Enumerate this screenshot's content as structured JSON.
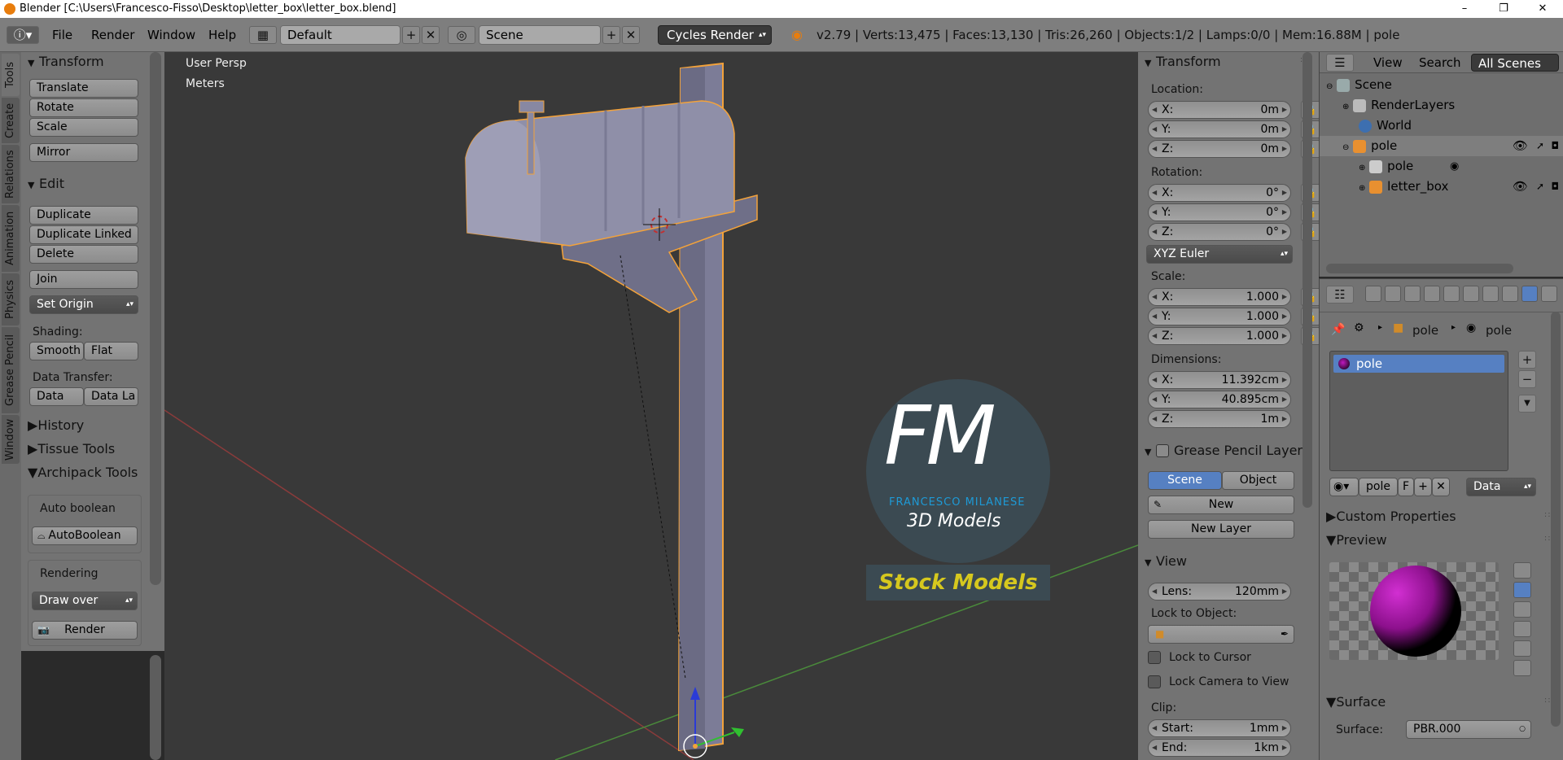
{
  "window": {
    "title": "Blender [C:\\Users\\Francesco-Fisso\\Desktop\\letter_box\\letter_box.blend]",
    "minimize": "–",
    "maximize": "❐",
    "close": "✕"
  },
  "menubar": {
    "menus": [
      "File",
      "Render",
      "Window",
      "Help"
    ],
    "screen_layout": "Default",
    "scene": "Scene",
    "engine": "Cycles Render",
    "stats": "v2.79 | Verts:13,475 | Faces:13,130 | Tris:26,260 | Objects:1/2 | Lamps:0/0 | Mem:16.88M | pole"
  },
  "vtabs": [
    "Tools",
    "Create",
    "Relations",
    "Animation",
    "Physics",
    "Grease Pencil",
    "Window"
  ],
  "toolshelf": {
    "transform_header": "Transform",
    "translate": "Translate",
    "rotate": "Rotate",
    "scale": "Scale",
    "mirror": "Mirror",
    "edit_header": "Edit",
    "duplicate": "Duplicate",
    "duplicate_linked": "Duplicate Linked",
    "delete": "Delete",
    "join": "Join",
    "set_origin": "Set Origin",
    "shading_label": "Shading:",
    "smooth": "Smooth",
    "flat": "Flat",
    "data_transfer_label": "Data Transfer:",
    "data": "Data",
    "data_la": "Data La",
    "history": "History",
    "tissue_tools": "Tissue Tools",
    "archipack": "Archipack Tools",
    "auto_boolean_label": "Auto boolean",
    "autoboolean_btn": "AutoBoolean",
    "rendering_label": "Rendering",
    "draw_over": "Draw over",
    "render_btn": "Render"
  },
  "viewport": {
    "view_label": "User Persp",
    "units_label": "Meters",
    "watermark": {
      "logo": "FM",
      "name": "FRANCESCO MILANESE",
      "subtitle": "3D Models",
      "tagline": "Stock Models"
    }
  },
  "npanel": {
    "transform_header": "Transform",
    "location_label": "Location:",
    "loc_x": {
      "k": "X:",
      "v": "0m"
    },
    "loc_y": {
      "k": "Y:",
      "v": "0m"
    },
    "loc_z": {
      "k": "Z:",
      "v": "0m"
    },
    "rotation_label": "Rotation:",
    "rot_x": {
      "k": "X:",
      "v": "0°"
    },
    "rot_y": {
      "k": "Y:",
      "v": "0°"
    },
    "rot_z": {
      "k": "Z:",
      "v": "0°"
    },
    "rotation_mode": "XYZ Euler",
    "scale_label": "Scale:",
    "scl_x": {
      "k": "X:",
      "v": "1.000"
    },
    "scl_y": {
      "k": "Y:",
      "v": "1.000"
    },
    "scl_z": {
      "k": "Z:",
      "v": "1.000"
    },
    "dimensions_label": "Dimensions:",
    "dim_x": {
      "k": "X:",
      "v": "11.392cm"
    },
    "dim_y": {
      "k": "Y:",
      "v": "40.895cm"
    },
    "dim_z": {
      "k": "Z:",
      "v": "1m"
    },
    "grease_pencil_header": "Grease Pencil Layer",
    "gp_scene": "Scene",
    "gp_object": "Object",
    "gp_new": "New",
    "gp_new_layer": "New Layer",
    "view_header": "View",
    "lens": {
      "k": "Lens:",
      "v": "120mm"
    },
    "lock_to_object_label": "Lock to Object:",
    "lock_to_cursor": "Lock to Cursor",
    "lock_camera": "Lock Camera to View",
    "clip_label": "Clip:",
    "clip_start": {
      "k": "Start:",
      "v": "1mm"
    },
    "clip_end": {
      "k": "End:",
      "v": "1km"
    }
  },
  "outliner": {
    "view": "View",
    "search": "Search",
    "filter": "All Scenes",
    "rows": [
      "Scene",
      "RenderLayers",
      "World",
      "pole",
      "pole",
      "letter_box"
    ]
  },
  "properties": {
    "breadcrumb_obj": "pole",
    "breadcrumb_mat": "pole",
    "material_slot": "pole",
    "material_name": "pole",
    "fake_user": "F",
    "link": "Data",
    "custom_properties": "Custom Properties",
    "preview": "Preview",
    "surface_header": "Surface",
    "surface_label": "Surface:",
    "surface_value": "PBR.000"
  },
  "colors": {
    "accent": "#5680c2",
    "selection_orange": "#f3a23a",
    "logo_blue": "#1e9ad6",
    "tagline_yellow": "#d6c81e"
  }
}
